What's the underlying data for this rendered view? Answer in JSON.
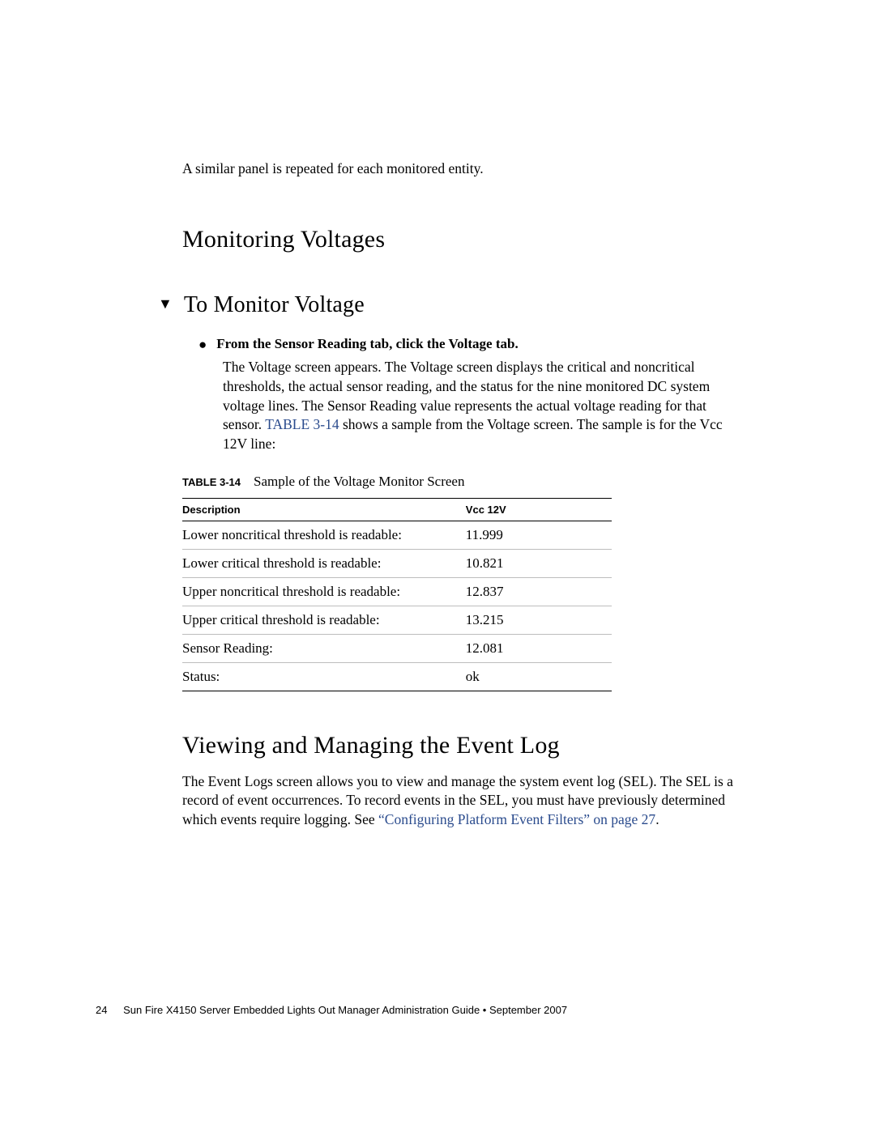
{
  "intro": "A similar panel is repeated for each monitored entity.",
  "section1": {
    "title": "Monitoring Voltages"
  },
  "task": {
    "title": "To Monitor Voltage",
    "step_bold": "From the Sensor Reading tab, click the Voltage tab.",
    "body_pre": "The Voltage screen appears. The Voltage screen displays the critical and noncritical thresholds, the actual sensor reading, and the status for the nine monitored DC system voltage lines. The Sensor Reading value represents the actual voltage reading for that sensor. ",
    "xref": "TABLE 3-14",
    "body_post": " shows a sample from the Voltage screen. The sample is for the Vcc 12V line:"
  },
  "table": {
    "caption_label": "TABLE 3-14",
    "caption_text": "Sample of the Voltage Monitor Screen",
    "headers": {
      "c1": "Description",
      "c2": "Vcc 12V"
    },
    "rows": [
      {
        "d": "Lower noncritical threshold is readable:",
        "v": "11.999"
      },
      {
        "d": "Lower critical threshold is readable:",
        "v": "10.821"
      },
      {
        "d": "Upper noncritical threshold is readable:",
        "v": "12.837"
      },
      {
        "d": "Upper critical threshold is readable:",
        "v": "13.215"
      },
      {
        "d": "Sensor Reading:",
        "v": "12.081"
      },
      {
        "d": "Status:",
        "v": "ok"
      }
    ]
  },
  "section2": {
    "title": "Viewing and Managing the Event Log",
    "para_pre": "The Event Logs screen allows you to view and manage the system event log (SEL). The SEL is a record of event occurrences. To record events in the SEL, you must have previously determined which events require logging. See ",
    "xref": "“Configuring Platform Event Filters” on page 27",
    "para_post": "."
  },
  "footer": {
    "page": "24",
    "text": "Sun Fire X4150 Server Embedded Lights Out Manager Administration Guide • September 2007"
  }
}
